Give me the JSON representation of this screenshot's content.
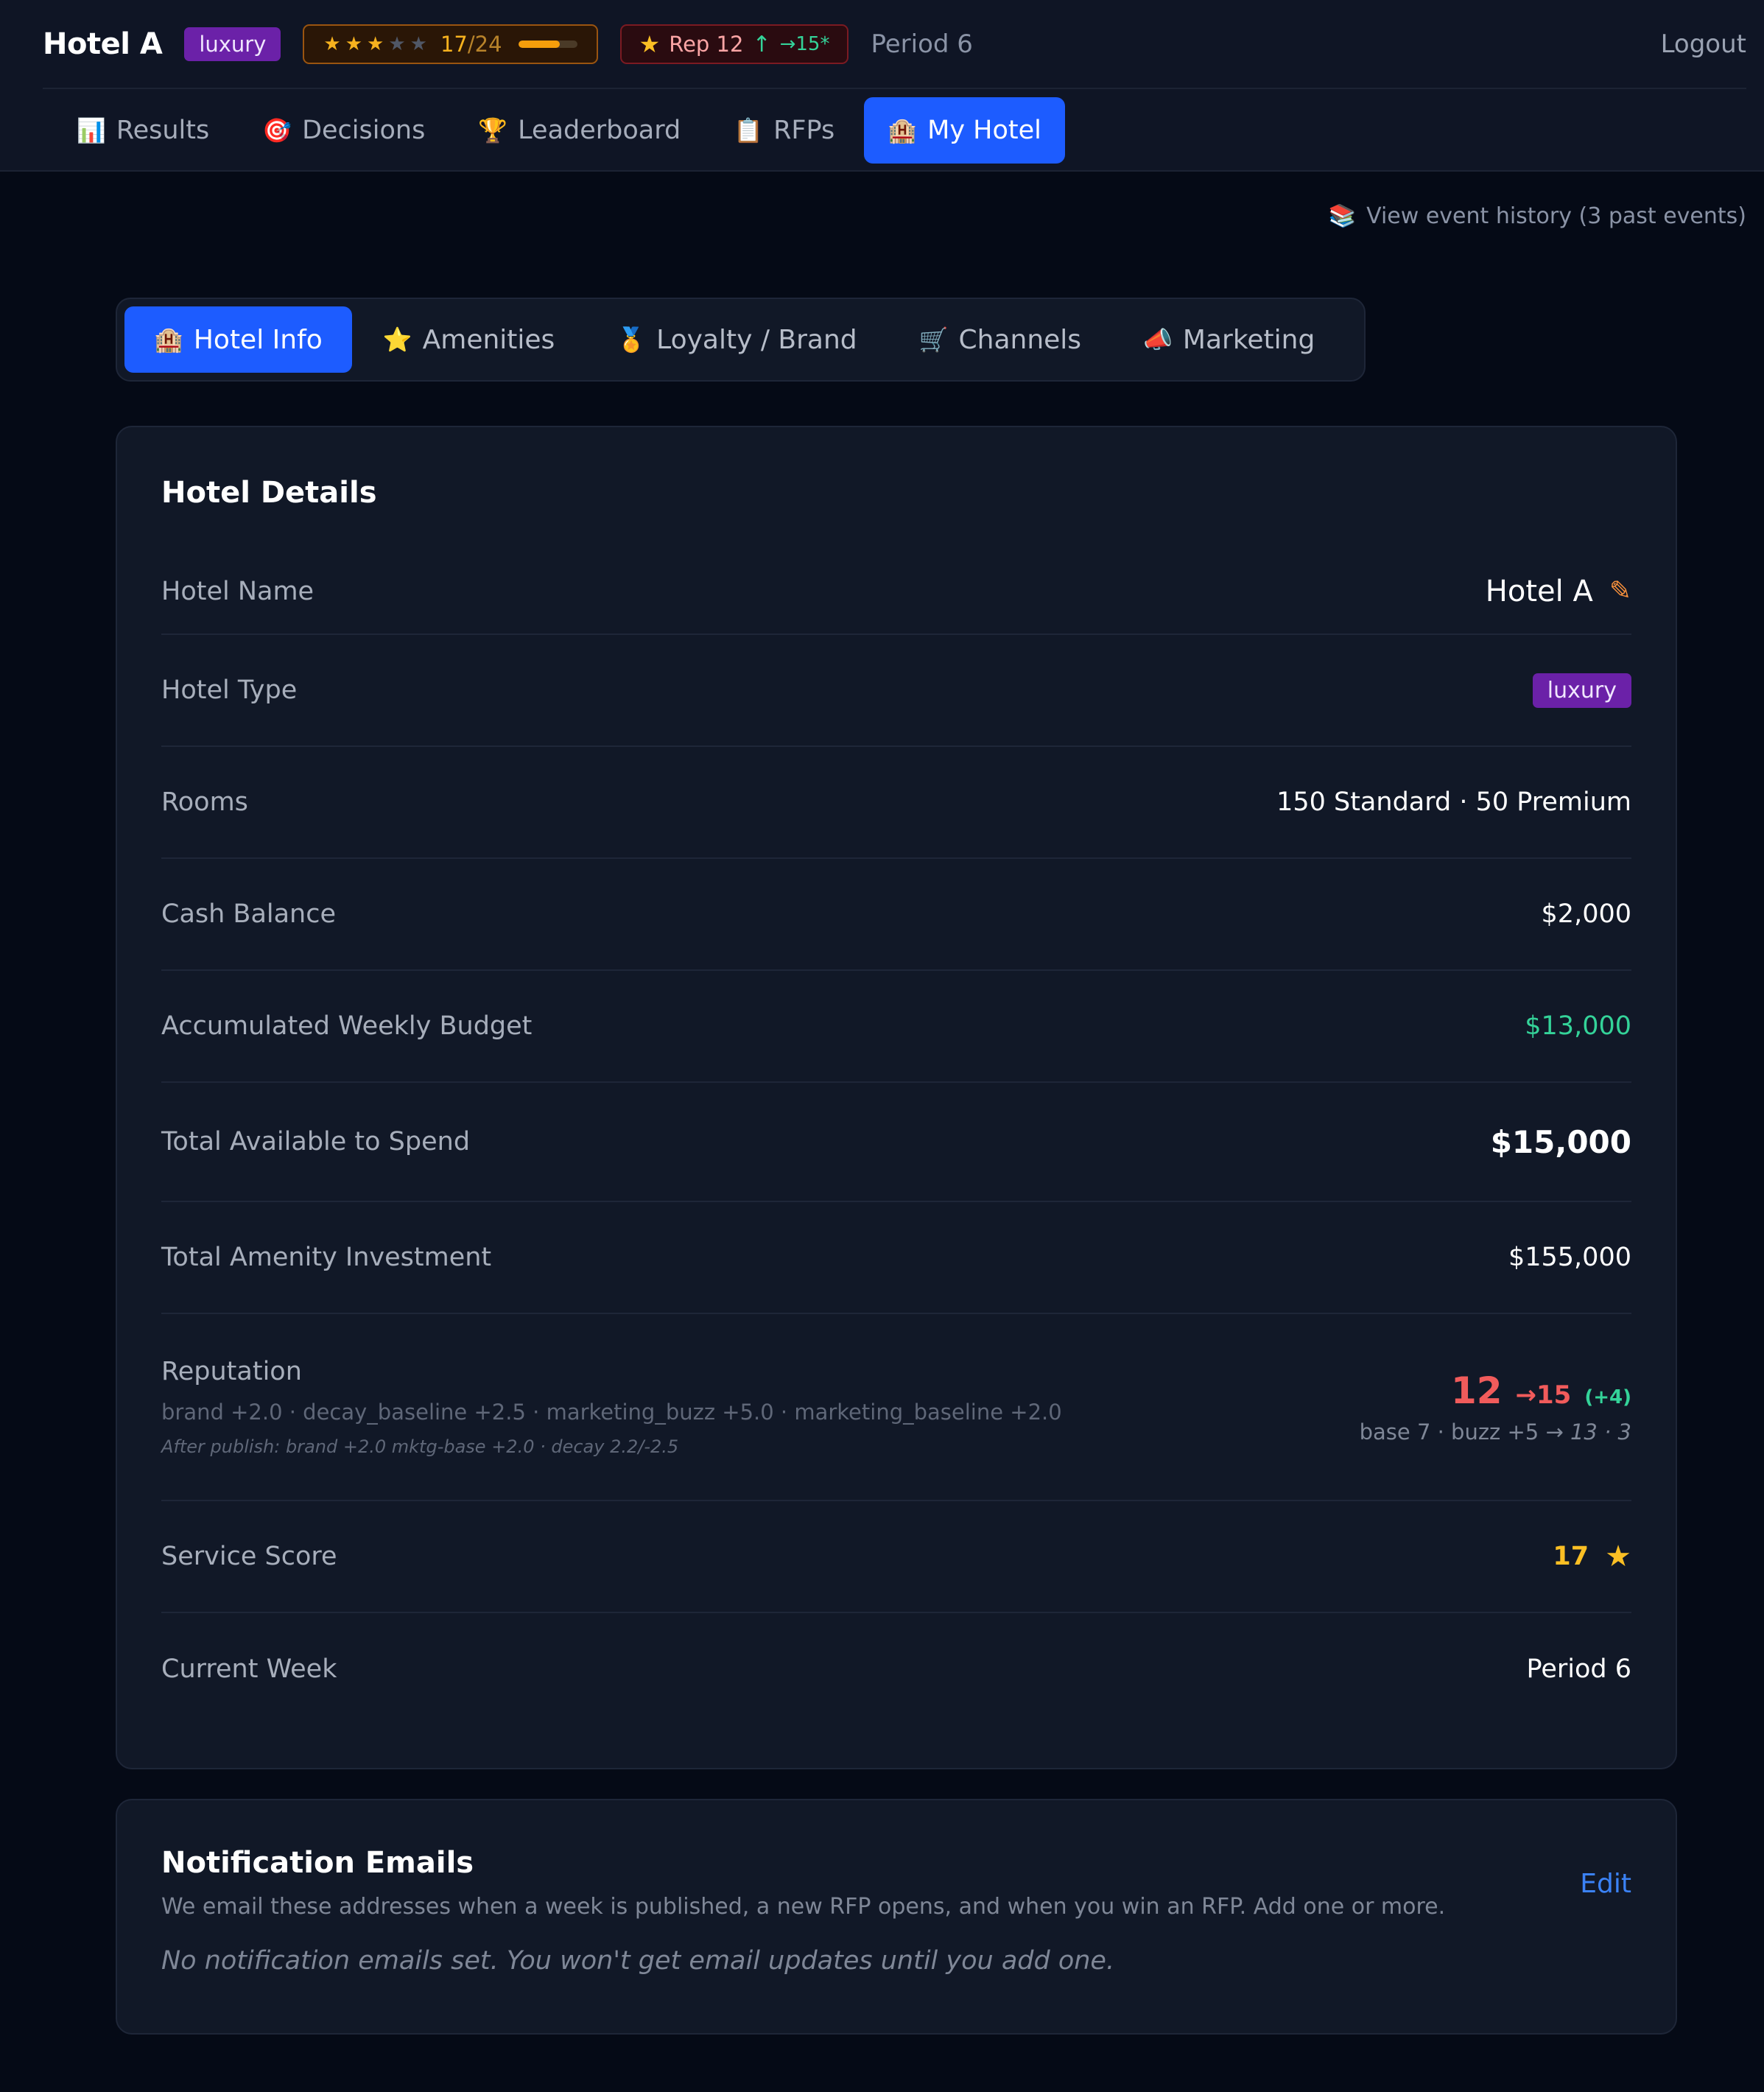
{
  "header": {
    "brand": "Hotel A",
    "type_badge": "luxury",
    "stars": {
      "filled": 3,
      "total": 5,
      "score": "17",
      "max": "/24",
      "progress": 0.71
    },
    "reputation": {
      "label": "Rep 12",
      "up_icon": "↑",
      "next": "→15",
      "next_suffix": "*"
    },
    "period": "Period 6",
    "logout": "Logout"
  },
  "nav": {
    "tabs": [
      {
        "icon": "📊",
        "label": "Results"
      },
      {
        "icon": "🎯",
        "label": "Decisions"
      },
      {
        "icon": "🏆",
        "label": "Leaderboard"
      },
      {
        "icon": "📋",
        "label": "RFPs"
      },
      {
        "icon": "🏨",
        "label": "My Hotel",
        "active": true
      }
    ]
  },
  "event_history": {
    "icon": "📚",
    "label": "View event history (3 past events)"
  },
  "subtabs": [
    {
      "icon": "🏨",
      "label": "Hotel Info",
      "active": true
    },
    {
      "icon": "⭐",
      "label": "Amenities"
    },
    {
      "icon": "🏅",
      "label": "Loyalty / Brand"
    },
    {
      "icon": "🛒",
      "label": "Channels"
    },
    {
      "icon": "📣",
      "label": "Marketing"
    }
  ],
  "details": {
    "title": "Hotel Details",
    "hotel_name": {
      "label": "Hotel Name",
      "value": "Hotel A"
    },
    "hotel_type": {
      "label": "Hotel Type",
      "value": "luxury"
    },
    "rooms": {
      "label": "Rooms",
      "value": "150 Standard · 50 Premium"
    },
    "cash": {
      "label": "Cash Balance",
      "value": "$2,000"
    },
    "weekly_budget": {
      "label": "Accumulated Weekly Budget",
      "value": "$13,000"
    },
    "total_available": {
      "label": "Total Available to Spend",
      "value": "$15,000"
    },
    "amenity_investment": {
      "label": "Total Amenity Investment",
      "value": "$155,000"
    },
    "reputation": {
      "label": "Reputation",
      "breakdown": "brand +2.0 · decay_baseline +2.5 · marketing_buzz +5.0 · marketing_baseline +2.0",
      "after_publish": "After publish: brand +2.0 mktg-base +2.0 · decay 2.2/-2.5",
      "current": "12",
      "target": "→15",
      "delta": "(+4)",
      "base_line": "base 7 · buzz +5 → ",
      "base_line_italic": "13 · 3"
    },
    "service": {
      "label": "Service Score",
      "value": "17"
    },
    "week": {
      "label": "Current Week",
      "value": "Period 6"
    }
  },
  "notifications": {
    "title": "Notification Emails",
    "description": "We email these addresses when a week is published, a new RFP opens, and when you win an RFP. Add one or more.",
    "empty": "No notification emails set. You won't get email updates until you add one.",
    "edit": "Edit"
  },
  "colors": {
    "background": "#050a16",
    "panel": "#111827",
    "accent": "#1d5cff",
    "luxury_badge": "#6b21a8",
    "positive": "#34d399",
    "negative": "#f15b5b",
    "gold": "#fbbf24"
  }
}
